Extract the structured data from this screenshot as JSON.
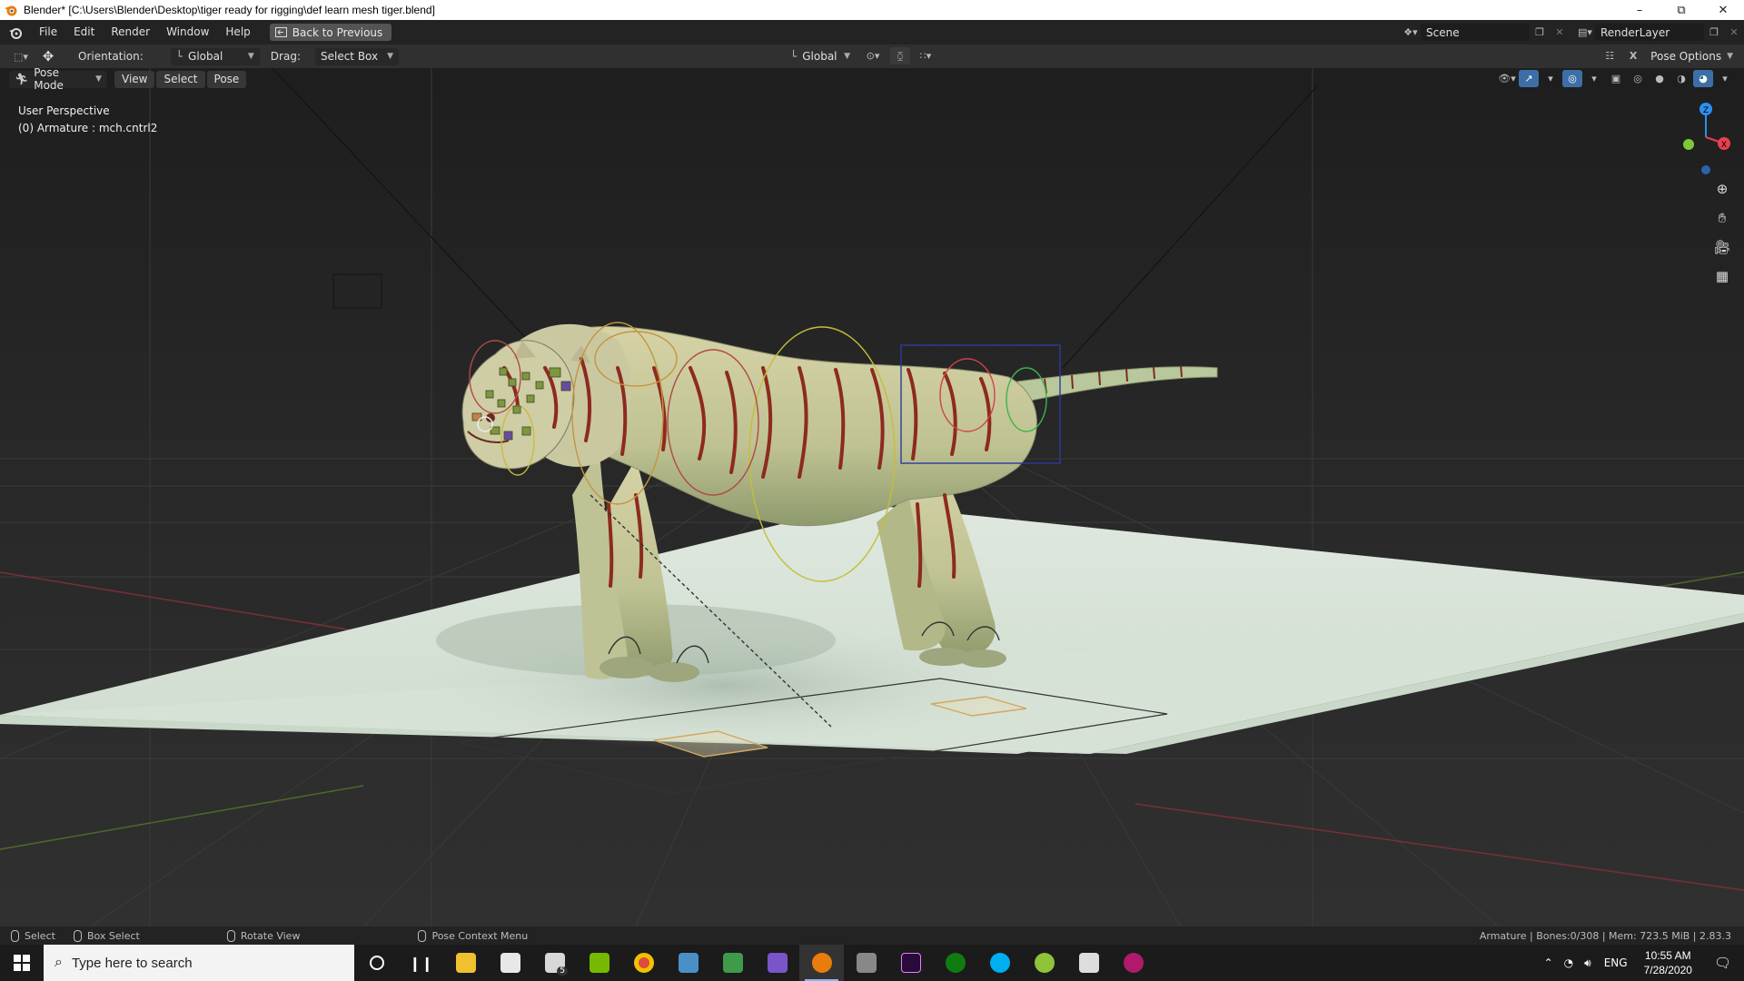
{
  "window": {
    "title": "Blender* [C:\\Users\\Blender\\Desktop\\tiger ready for rigging\\def learn mesh tiger.blend]",
    "controls": [
      "minimize",
      "restore",
      "close"
    ]
  },
  "menubar": {
    "items": [
      "File",
      "Edit",
      "Render",
      "Window",
      "Help"
    ],
    "back_button": "Back to Previous",
    "scene_name": "Scene",
    "render_layer": "RenderLayer"
  },
  "toolheader": {
    "orientation_label": "Orientation:",
    "orientation_value": "Global",
    "drag_label": "Drag:",
    "drag_value": "Select Box",
    "transform_orientation": "Global",
    "pose_options": "Pose Options"
  },
  "viewheader": {
    "mode": "Pose Mode",
    "menus": [
      "View",
      "Select",
      "Pose"
    ]
  },
  "viewport": {
    "perspective_label": "User Perspective",
    "active_object": "(0) Armature : mch.cntrl2",
    "gizmo_axes": {
      "x": "X",
      "z": "Z"
    },
    "axis_colors": {
      "x": "#e8404f",
      "y": "#7ec83a",
      "z": "#2f8ff0"
    }
  },
  "statusbar": {
    "hints": [
      {
        "label": "Select"
      },
      {
        "label": "Box Select"
      },
      {
        "label": "Rotate View"
      },
      {
        "label": "Pose Context Menu"
      }
    ],
    "stats": "Armature | Bones:0/308 | Mem: 723.5 MiB | 2.83.3"
  },
  "taskbar": {
    "search_placeholder": "Type here to search",
    "mail_badge": "5",
    "language": "ENG",
    "time": "10:55 AM",
    "date": "7/28/2020",
    "apps": [
      "cortana",
      "task-view",
      "file-explorer",
      "store",
      "mail",
      "nvidia",
      "chrome",
      "calculator-app",
      "camtasia",
      "visual-studio",
      "blender",
      "tool",
      "premiere-pro",
      "xbox",
      "skype",
      "other",
      "calculator",
      "photo-app"
    ]
  }
}
